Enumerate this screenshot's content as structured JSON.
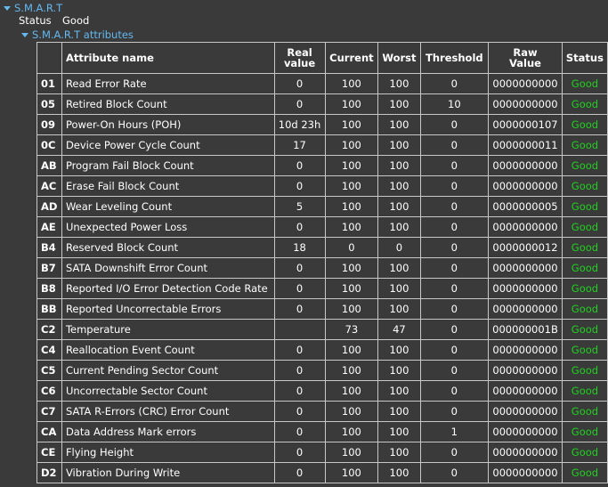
{
  "tree": {
    "smart_label": "S.M.A.R.T",
    "status_label": "Status",
    "status_value": "Good",
    "attributes_label": "S.M.A.R.T attributes"
  },
  "columns": {
    "id": "",
    "name": "Attribute name",
    "real": "Real\nvalue",
    "current": "Current",
    "worst": "Worst",
    "threshold": "Threshold",
    "raw": "Raw\nValue",
    "status": "Status"
  },
  "colors": {
    "accent": "#63b8f0",
    "good": "#1ed21e",
    "background": "#3a3a3a"
  },
  "rows": [
    {
      "id": "01",
      "name": "Read Error Rate",
      "real": "0",
      "current": "100",
      "worst": "100",
      "threshold": "0",
      "raw": "0000000000",
      "status": "Good"
    },
    {
      "id": "05",
      "name": "Retired Block Count",
      "real": "0",
      "current": "100",
      "worst": "100",
      "threshold": "10",
      "raw": "0000000000",
      "status": "Good"
    },
    {
      "id": "09",
      "name": "Power-On Hours (POH)",
      "real": "10d 23h",
      "current": "100",
      "worst": "100",
      "threshold": "0",
      "raw": "0000000107",
      "status": "Good"
    },
    {
      "id": "0C",
      "name": "Device Power Cycle Count",
      "real": "17",
      "current": "100",
      "worst": "100",
      "threshold": "0",
      "raw": "0000000011",
      "status": "Good"
    },
    {
      "id": "AB",
      "name": "Program Fail Block Count",
      "real": "0",
      "current": "100",
      "worst": "100",
      "threshold": "0",
      "raw": "0000000000",
      "status": "Good"
    },
    {
      "id": "AC",
      "name": "Erase Fail Block Count",
      "real": "0",
      "current": "100",
      "worst": "100",
      "threshold": "0",
      "raw": "0000000000",
      "status": "Good"
    },
    {
      "id": "AD",
      "name": "Wear Leveling Count",
      "real": "5",
      "current": "100",
      "worst": "100",
      "threshold": "0",
      "raw": "0000000005",
      "status": "Good"
    },
    {
      "id": "AE",
      "name": "Unexpected Power Loss",
      "real": "0",
      "current": "100",
      "worst": "100",
      "threshold": "0",
      "raw": "0000000000",
      "status": "Good"
    },
    {
      "id": "B4",
      "name": "Reserved Block Count",
      "real": "18",
      "current": "0",
      "worst": "0",
      "threshold": "0",
      "raw": "0000000012",
      "status": "Good"
    },
    {
      "id": "B7",
      "name": "SATA Downshift Error Count",
      "real": "0",
      "current": "100",
      "worst": "100",
      "threshold": "0",
      "raw": "0000000000",
      "status": "Good"
    },
    {
      "id": "B8",
      "name": "Reported I/O Error Detection Code Rate",
      "real": "0",
      "current": "100",
      "worst": "100",
      "threshold": "0",
      "raw": "0000000000",
      "status": "Good"
    },
    {
      "id": "BB",
      "name": "Reported Uncorrectable Errors",
      "real": "0",
      "current": "100",
      "worst": "100",
      "threshold": "0",
      "raw": "0000000000",
      "status": "Good"
    },
    {
      "id": "C2",
      "name": "Temperature",
      "real": "",
      "current": "73",
      "worst": "47",
      "threshold": "0",
      "raw": "000000001B",
      "status": "Good"
    },
    {
      "id": "C4",
      "name": "Reallocation Event Count",
      "real": "0",
      "current": "100",
      "worst": "100",
      "threshold": "0",
      "raw": "0000000000",
      "status": "Good"
    },
    {
      "id": "C5",
      "name": "Current Pending Sector Count",
      "real": "0",
      "current": "100",
      "worst": "100",
      "threshold": "0",
      "raw": "0000000000",
      "status": "Good"
    },
    {
      "id": "C6",
      "name": "Uncorrectable Sector Count",
      "real": "0",
      "current": "100",
      "worst": "100",
      "threshold": "0",
      "raw": "0000000000",
      "status": "Good"
    },
    {
      "id": "C7",
      "name": "SATA R-Errors (CRC) Error Count",
      "real": "0",
      "current": "100",
      "worst": "100",
      "threshold": "0",
      "raw": "0000000000",
      "status": "Good"
    },
    {
      "id": "CA",
      "name": "Data Address Mark errors",
      "real": "0",
      "current": "100",
      "worst": "100",
      "threshold": "1",
      "raw": "0000000000",
      "status": "Good"
    },
    {
      "id": "CE",
      "name": "Flying Height",
      "real": "0",
      "current": "100",
      "worst": "100",
      "threshold": "0",
      "raw": "0000000000",
      "status": "Good"
    },
    {
      "id": "D2",
      "name": "Vibration During Write",
      "real": "0",
      "current": "100",
      "worst": "100",
      "threshold": "0",
      "raw": "0000000000",
      "status": "Good"
    }
  ]
}
